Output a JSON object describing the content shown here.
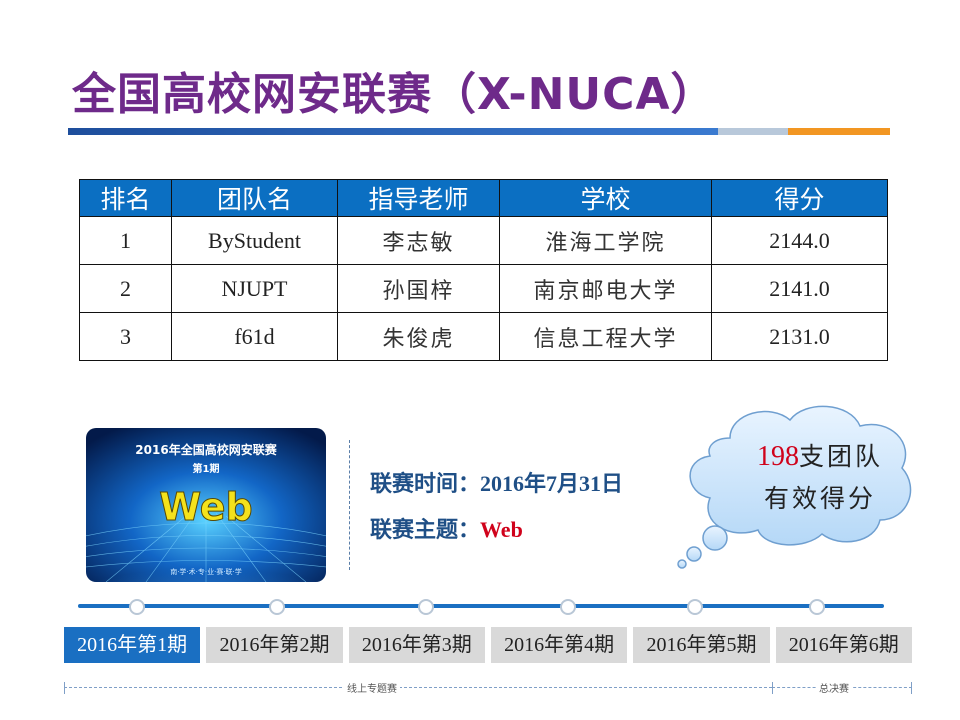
{
  "page": {
    "title": "全国高校网安联赛（X-NUCA）"
  },
  "ranking_table": {
    "headers": [
      "排名",
      "团队名",
      "指导老师",
      "学校",
      "得分"
    ],
    "rows": [
      {
        "rank": "1",
        "team": "ByStudent",
        "advisor": "李志敏",
        "school": "淮海工学院",
        "score": "2144.0"
      },
      {
        "rank": "2",
        "team": "NJUPT",
        "advisor": "孙国梓",
        "school": "南京邮电大学",
        "score": "2141.0"
      },
      {
        "rank": "3",
        "team": "f61d",
        "advisor": "朱俊虎",
        "school": "信息工程大学",
        "score": "2131.0"
      }
    ]
  },
  "event_image": {
    "title": "2016年全国高校网安联赛",
    "issue": "第1期",
    "theme": "Web",
    "footer": "南·学·术·专·业·赛·联·学"
  },
  "event_info": {
    "time_label": "联赛时间：",
    "time_value": "2016年7月31日",
    "theme_label": "联赛主题：",
    "theme_value": "Web"
  },
  "callout": {
    "number": "198",
    "line1_suffix": "支团队",
    "line2": "有效得分"
  },
  "timeline": {
    "tabs": [
      "2016年第1期",
      "2016年第2期",
      "2016年第3期",
      "2016年第4期",
      "2016年第5期",
      "2016年第6期"
    ],
    "active_index": 0,
    "online_label": "线上专题赛",
    "final_label": "总决赛"
  },
  "colors": {
    "title": "#6e2a8a",
    "header_bg": "#0b6fc2",
    "accent_blue": "#1a6fc2",
    "accent_orange": "#f29622",
    "highlight_red": "#d0021b"
  }
}
